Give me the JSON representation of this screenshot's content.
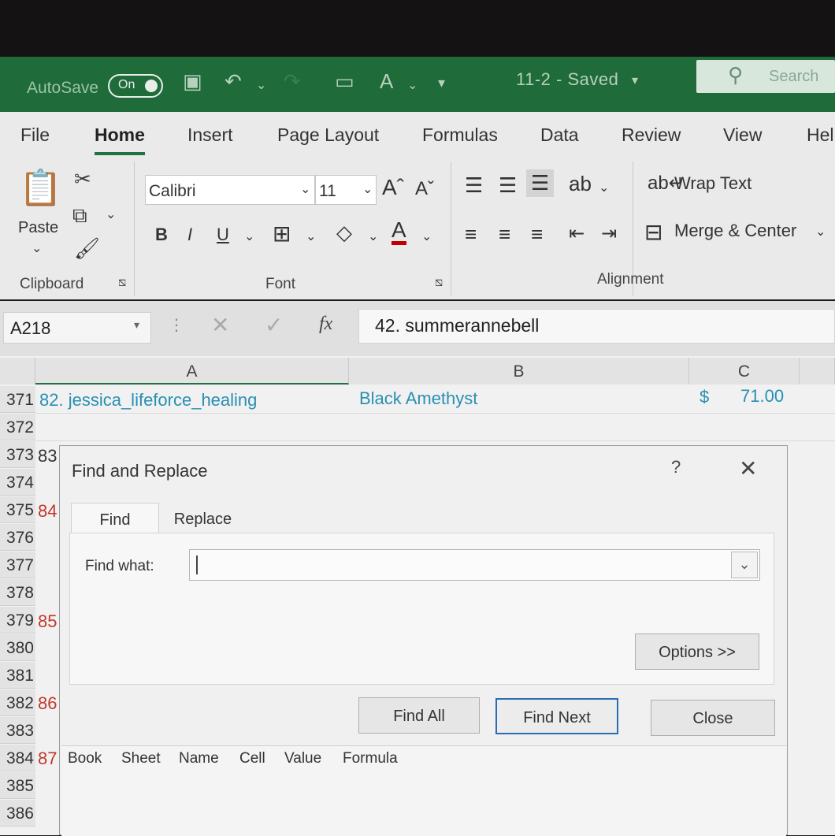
{
  "titlebar": {
    "autosave_label": "AutoSave",
    "toggle_label": "On",
    "doc_title": "11-2  -  Saved",
    "search_placeholder": "Search"
  },
  "ribbon": {
    "tabs": [
      "File",
      "Home",
      "Insert",
      "Page Layout",
      "Formulas",
      "Data",
      "Review",
      "View",
      "Hel"
    ],
    "active_tab": "Home",
    "clipboard": {
      "paste_label": "Paste",
      "group_label": "Clipboard"
    },
    "font": {
      "name": "Calibri",
      "size": "11",
      "group_label": "Font",
      "bold": "B",
      "italic": "I",
      "underline": "U"
    },
    "alignment": {
      "wrap_text": "Wrap Text",
      "merge_center": "Merge & Center",
      "group_label": "Alignment"
    }
  },
  "formula_bar": {
    "name_box": "A218",
    "fx": "fx",
    "content": "42. summerannebell"
  },
  "sheet": {
    "columns": [
      "A",
      "B",
      "C"
    ],
    "rows": [
      "371",
      "372",
      "373",
      "374",
      "375",
      "376",
      "377",
      "378",
      "379",
      "380",
      "381",
      "382",
      "383",
      "384",
      "385",
      "386"
    ],
    "row371": {
      "a": "82. jessica_lifeforce_healing",
      "b": "Black Amethyst",
      "c_currency": "$",
      "c_value": "71.00"
    },
    "a_partial": {
      "373": "83",
      "375": "84",
      "379": "85",
      "382": "86",
      "384": "87"
    }
  },
  "dialog": {
    "title": "Find and Replace",
    "help": "?",
    "tabs": [
      "Find",
      "Replace"
    ],
    "find_what_label": "Find what:",
    "find_what_value": "",
    "options_button": "Options >>",
    "find_all_button": "Find All",
    "find_next_button": "Find Next",
    "close_button": "Close",
    "result_columns": [
      "Book",
      "Sheet",
      "Name",
      "Cell",
      "Value",
      "Formula"
    ]
  },
  "colors": {
    "excel_green": "#1f6b3a",
    "accent_blue": "#2b6cb3",
    "cell_teal": "#2a8fb3"
  }
}
